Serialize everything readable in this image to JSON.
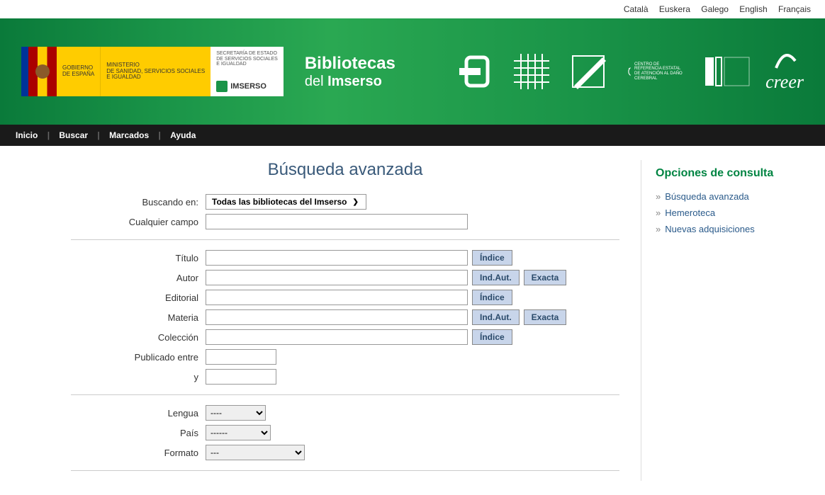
{
  "languages": [
    "Català",
    "Euskera",
    "Galego",
    "English",
    "Français"
  ],
  "header": {
    "gobierno": "GOBIERNO\nDE ESPAÑA",
    "ministerio": "MINISTERIO\nDE SANIDAD, SERVICIOS SOCIALES\nE IGUALDAD",
    "secretaria": "SECRETARÍA DE ESTADO\nDE SERVICIOS SOCIALES\nE IGUALDAD",
    "imserso": "IMSERSO",
    "title_line1": "Bibliotecas",
    "title_line2_pre": "del ",
    "title_line2_bold": "Imserso",
    "ceadac_text": "CENTRO DE REFERENCIA ESTATAL DE ATENCIÓN AL DAÑO CEREBRAL",
    "creer": "creer"
  },
  "nav": [
    "Inicio",
    "Buscar",
    "Marcados",
    "Ayuda"
  ],
  "page_title": "Búsqueda avanzada",
  "form": {
    "buscando_en_label": "Buscando en:",
    "buscando_en_value": "Todas las bibliotecas del Imserso",
    "cualquier_campo_label": "Cualquier campo",
    "titulo_label": "Título",
    "autor_label": "Autor",
    "editorial_label": "Editorial",
    "materia_label": "Materia",
    "coleccion_label": "Colección",
    "publicado_entre_label": "Publicado entre",
    "y_label": "y",
    "lengua_label": "Lengua",
    "pais_label": "País",
    "formato_label": "Formato",
    "btn_indice": "Índice",
    "btn_ind_aut": "Ind.Aut.",
    "btn_exacta": "Exacta",
    "lengua_default": "----",
    "pais_default": "------",
    "formato_default": "---"
  },
  "sidebar": {
    "title": "Opciones de consulta",
    "links": [
      "Búsqueda avanzada",
      "Hemeroteca",
      "Nuevas adquisiciones"
    ]
  }
}
